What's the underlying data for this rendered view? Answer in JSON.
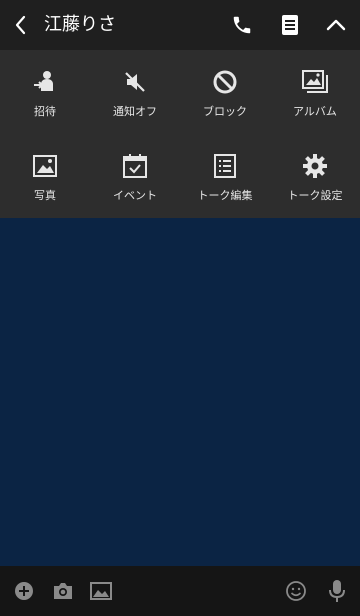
{
  "header": {
    "title": "江藤りさ",
    "icons": [
      "back-chevron",
      "phone",
      "notes",
      "collapse-chevron"
    ]
  },
  "menu": {
    "items": [
      {
        "label": "招待",
        "icon": "invite"
      },
      {
        "label": "通知オフ",
        "icon": "mute"
      },
      {
        "label": "ブロック",
        "icon": "block"
      },
      {
        "label": "アルバム",
        "icon": "album"
      },
      {
        "label": "写真",
        "icon": "photo"
      },
      {
        "label": "イベント",
        "icon": "event"
      },
      {
        "label": "トーク編集",
        "icon": "edit-talk"
      },
      {
        "label": "トーク設定",
        "icon": "settings"
      }
    ]
  },
  "bottom_bar": {
    "icons": [
      "plus",
      "camera",
      "image",
      "emoji",
      "mic"
    ]
  },
  "colors": {
    "header_bg": "#1f1f1f",
    "menu_bg": "#2d2d2d",
    "chat_bg": "#0b2444",
    "bottom_bg": "#151515",
    "icon": "#e6e6e6"
  }
}
